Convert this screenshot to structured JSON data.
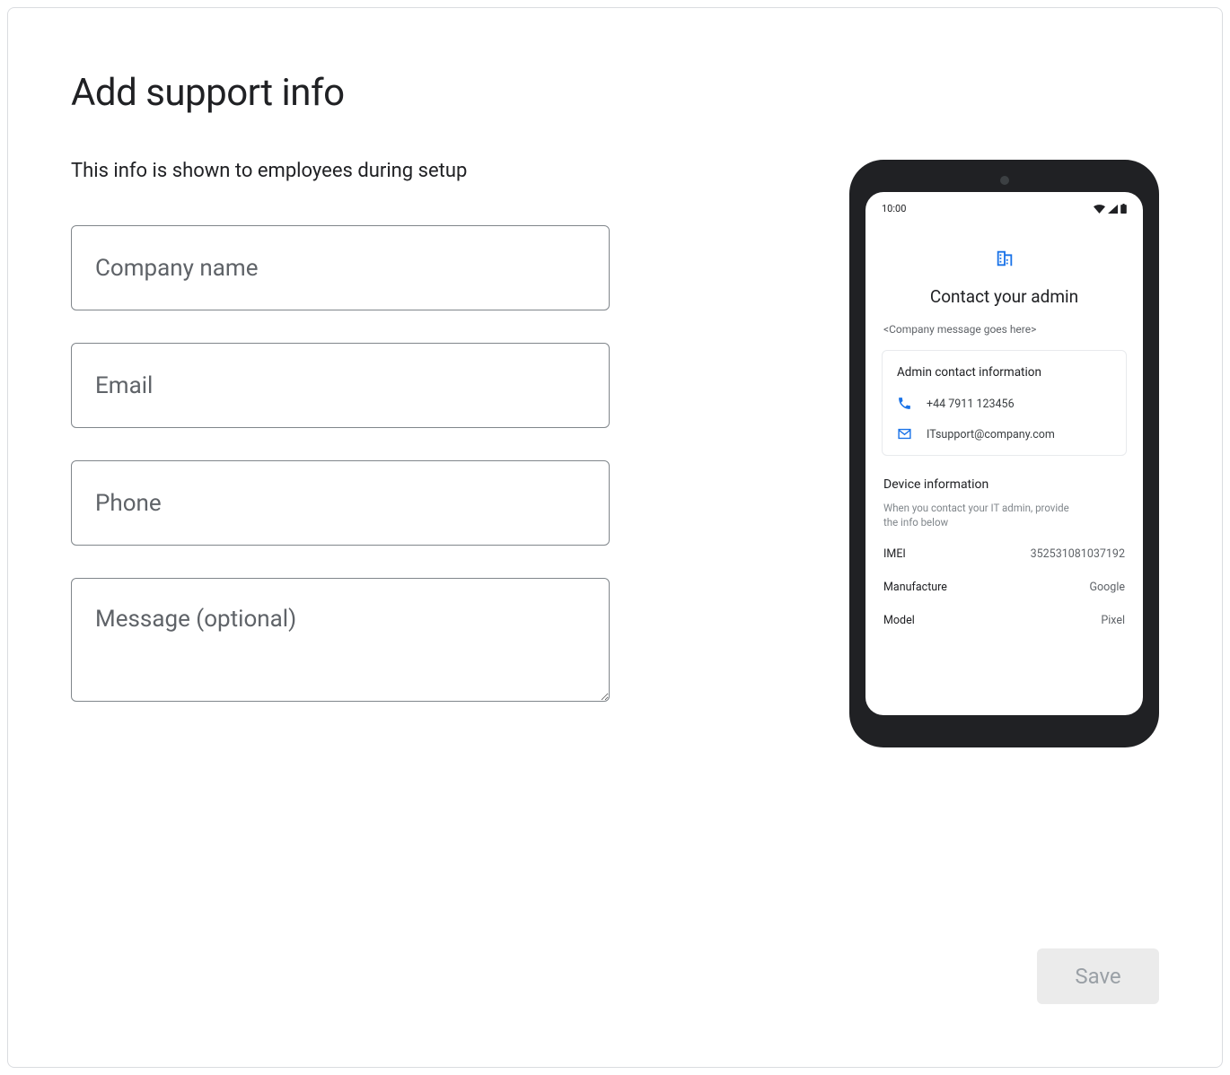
{
  "page": {
    "title": "Add support info",
    "subtitle": "This info is shown to employees during setup"
  },
  "form": {
    "company_placeholder": "Company name",
    "email_placeholder": "Email",
    "phone_placeholder": "Phone",
    "message_placeholder": "Message (optional)"
  },
  "preview": {
    "time": "10:00",
    "heading": "Contact your admin",
    "placeholder_msg": "<Company message goes here>",
    "admin_card_title": "Admin contact information",
    "phone_sample": "+44 7911 123456",
    "email_sample": "ITsupport@company.com",
    "device_section_title": "Device information",
    "device_section_sub": "When you contact your IT admin, provide the info below",
    "imei_label": "IMEI",
    "imei_value": "352531081037192",
    "manufacture_label": "Manufacture",
    "manufacture_value": "Google",
    "model_label": "Model",
    "model_value": "Pixel"
  },
  "actions": {
    "save_label": "Save"
  },
  "colors": {
    "accent": "#1a73e8",
    "border": "#dadce0",
    "text_primary": "#202124",
    "text_secondary": "#5f6368"
  }
}
